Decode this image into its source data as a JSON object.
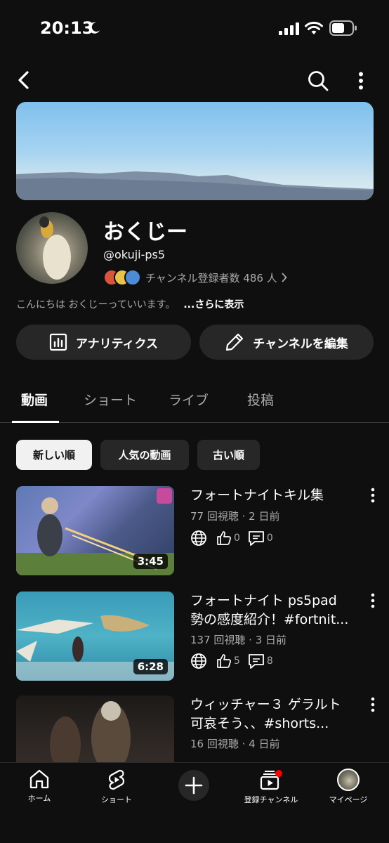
{
  "status_bar": {
    "time": "20:13"
  },
  "channel": {
    "name": "おくじー",
    "handle": "@okuji-ps5",
    "subscribers": "チャンネル登録者数 486 人",
    "description": "こんにちは おくじーっていいます。",
    "more_label": "...さらに表示"
  },
  "actions": {
    "analytics": "アナリティクス",
    "edit": "チャンネルを編集"
  },
  "tabs": [
    {
      "label": "動画"
    },
    {
      "label": "ショート"
    },
    {
      "label": "ライブ"
    },
    {
      "label": "投稿"
    }
  ],
  "active_tab": "動画",
  "filters": [
    {
      "label": "新しい順"
    },
    {
      "label": "人気の動画"
    },
    {
      "label": "古い順"
    }
  ],
  "active_filter": "新しい順",
  "videos": [
    {
      "title": [
        "フォートナイトキル集"
      ],
      "meta": "77 回視聴 · 2 日前",
      "duration": "3:45",
      "likes": "0",
      "comments": "0"
    },
    {
      "title": [
        "フォートナイト ps5pad",
        "勢の感度紹介！#fortnit..."
      ],
      "meta": "137 回視聴 · 3 日前",
      "duration": "6:28",
      "likes": "5",
      "comments": "8"
    },
    {
      "title": [
        "ウィッチャー３ ゲラルト",
        "可哀そう、、#shorts..."
      ],
      "meta": "16 回視聴 · 4 日前",
      "duration": "",
      "likes": "",
      "comments": ""
    }
  ],
  "bottom_nav": {
    "home": "ホーム",
    "shorts": "ショート",
    "subscriptions": "登録チャンネル",
    "you": "マイページ"
  },
  "colors": {
    "background": "#0f0f0f",
    "surface": "#272727",
    "text_secondary": "#aaaaaa",
    "notification": "#ff0000"
  },
  "icons": [
    "back-icon",
    "search-icon",
    "more-icon",
    "analytics-icon",
    "pencil-icon",
    "globe-icon",
    "like-icon",
    "comment-icon",
    "home-icon",
    "shorts-icon",
    "plus-icon",
    "subscriptions-icon"
  ]
}
